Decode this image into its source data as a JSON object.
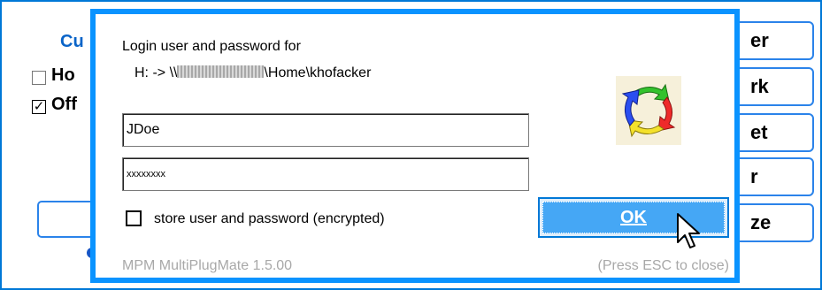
{
  "background": {
    "title_partial": "Cu",
    "checkboxes": [
      {
        "label": "Ho",
        "checked": false
      },
      {
        "label": "Off",
        "checked": true
      }
    ],
    "right_buttons": [
      "er",
      "rk",
      "et",
      "r",
      "ze"
    ]
  },
  "dialog": {
    "prompt": "Login user and password for",
    "path_prefix": "H: -> \\\\",
    "path_suffix": "\\Home\\khofacker",
    "username_value": "JDoe",
    "password_masked": "xxxxxxxx",
    "store_label": "store user and password (encrypted)",
    "store_checked": false,
    "ok_label": "OK",
    "app_version": "MPM MultiPlugMate 1.5.00",
    "esc_hint": "(Press ESC to close)"
  },
  "colors": {
    "dialog_border": "#0a93ff",
    "ok_fill": "#45a7f5",
    "bg_accent": "#0a64c8"
  },
  "icons": {
    "logo": "multiplugmate-logo-icon",
    "cursor": "mouse-pointer-icon"
  }
}
